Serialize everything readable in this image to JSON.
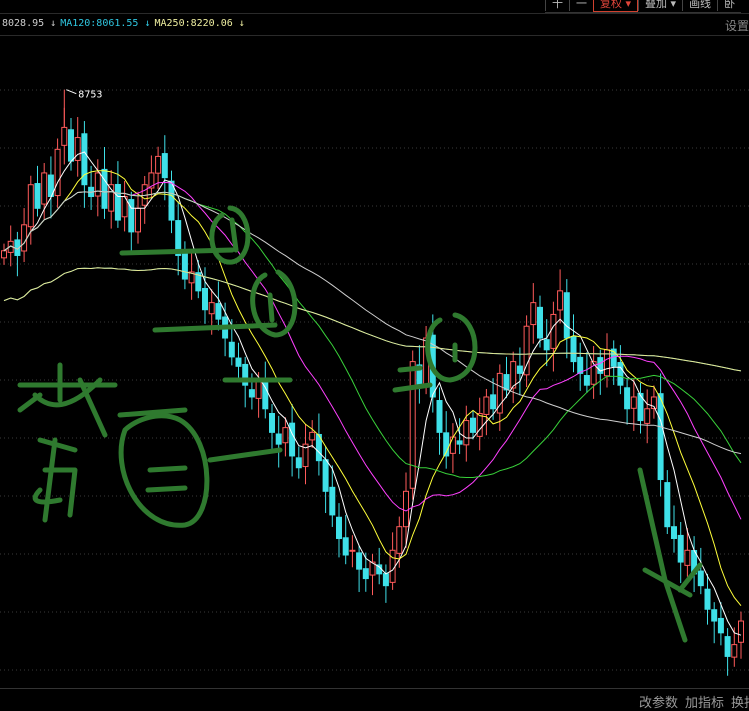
{
  "toolbar": {
    "items": [
      "十",
      "一",
      "复权 ▾",
      "叠加 ▾",
      "画线",
      "卧"
    ]
  },
  "legend": {
    "ma_prev": "8028.95 ↓",
    "ma120": "MA120:8061.55 ↓",
    "ma250": "MA250:8220.06 ↓",
    "settings": "设置"
  },
  "colors": {
    "up": "#ff5b5b",
    "down": "#3fe0e8",
    "ma5": "#ffffff",
    "ma10": "#ffff3a",
    "ma20": "#ff40ff",
    "ma30": "#39d13a",
    "ma60": "#cfcfcf",
    "ma120": "#2fa6c8",
    "ma250": "#e8e890",
    "annot": "#2f7a2f"
  },
  "chart_data": {
    "type": "candlestick",
    "high_label": "8753",
    "ylim": [
      6250,
      8900
    ],
    "closes": [
      8070,
      8110,
      8050,
      8180,
      8350,
      8250,
      8400,
      8300,
      8500,
      8593,
      8450,
      8550,
      8350,
      8300,
      8400,
      8250,
      8350,
      8200,
      8300,
      8150,
      8250,
      8350,
      8400,
      8470,
      8380,
      8200,
      8050,
      7950,
      7980,
      7900,
      7820,
      7850,
      7780,
      7700,
      7620,
      7580,
      7500,
      7450,
      7520,
      7400,
      7300,
      7250,
      7320,
      7200,
      7150,
      7250,
      7300,
      7180,
      7050,
      6950,
      6850,
      6780,
      6800,
      6720,
      6680,
      6750,
      6700,
      6650,
      6800,
      6900,
      7050,
      7600,
      7500,
      7700,
      7450,
      7300,
      7200,
      7280,
      7250,
      7350,
      7300,
      7380,
      7450,
      7400,
      7550,
      7480,
      7600,
      7550,
      7750,
      7850,
      7700,
      7650,
      7800,
      7900,
      7700,
      7600,
      7550,
      7500,
      7600,
      7550,
      7650,
      7580,
      7500,
      7400,
      7450,
      7350,
      7400,
      7450,
      7100,
      6900,
      6850,
      6750,
      6800,
      6700,
      6650,
      6550,
      6500,
      6450,
      6350,
      6400,
      6500
    ],
    "ma_periods": [
      5,
      10,
      20,
      30,
      60,
      120,
      250
    ]
  },
  "bottom": {
    "change_params": "改参数",
    "add_indicator": "加指标",
    "switch": "换指"
  }
}
